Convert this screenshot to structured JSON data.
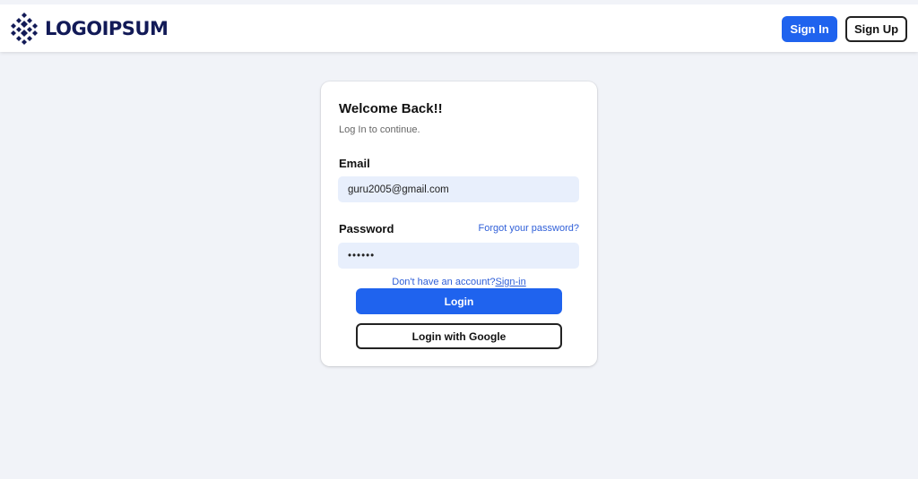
{
  "header": {
    "logo_text": "LOGOIPSUM",
    "sign_in_label": "Sign In",
    "sign_up_label": "Sign Up"
  },
  "login_card": {
    "title": "Welcome Back!!",
    "subtitle": "Log In to continue.",
    "email_label": "Email",
    "email_value": "guru2005@gmail.com",
    "password_label": "Password",
    "password_value": "••••••",
    "forgot_link": "Forgot your password?",
    "no_account_text": "Don't have an account?",
    "signup_link": "Sign-in",
    "login_button": "Login",
    "google_button": "Login with Google"
  },
  "colors": {
    "primary": "#1f63ee",
    "background": "#f1f3f8",
    "input_bg": "#e8effc",
    "logo": "#121a57",
    "link": "#2f5fd8"
  },
  "icons": {
    "logo": "diamond-pattern-logo-icon"
  }
}
